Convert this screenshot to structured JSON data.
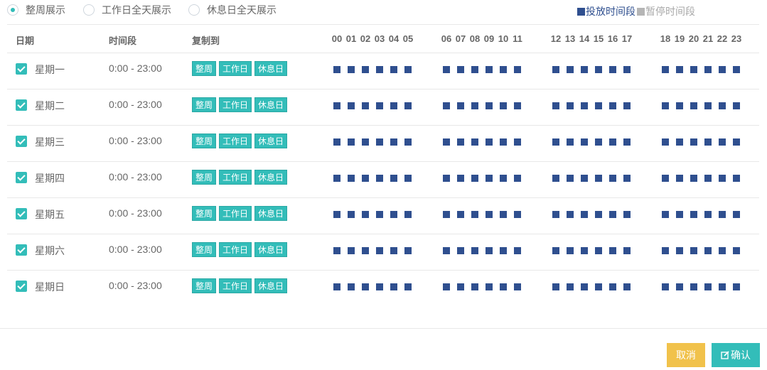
{
  "view_options": [
    {
      "label": "整周展示",
      "selected": true
    },
    {
      "label": "工作日全天展示",
      "selected": false
    },
    {
      "label": "休息日全天展示",
      "selected": false
    }
  ],
  "legend": {
    "active_label": "投放时间段",
    "paused_label": "暂停时间段",
    "active_color": "#2f4f8f",
    "paused_color": "#b5b5b5"
  },
  "table": {
    "headers": {
      "date": "日期",
      "time_range": "时间段",
      "copy_to": "复制到"
    },
    "hour_groups": [
      [
        "00",
        "01",
        "02",
        "03",
        "04",
        "05"
      ],
      [
        "06",
        "07",
        "08",
        "09",
        "10",
        "11"
      ],
      [
        "12",
        "13",
        "14",
        "15",
        "16",
        "17"
      ],
      [
        "18",
        "19",
        "20",
        "21",
        "22",
        "23"
      ]
    ],
    "copy_buttons": [
      "整周",
      "工作日",
      "休息日"
    ],
    "rows": [
      {
        "day": "星期一",
        "range": "0:00 - 23:00",
        "checked": true
      },
      {
        "day": "星期二",
        "range": "0:00 - 23:00",
        "checked": true
      },
      {
        "day": "星期三",
        "range": "0:00 - 23:00",
        "checked": true
      },
      {
        "day": "星期四",
        "range": "0:00 - 23:00",
        "checked": true
      },
      {
        "day": "星期五",
        "range": "0:00 - 23:00",
        "checked": true
      },
      {
        "day": "星期六",
        "range": "0:00 - 23:00",
        "checked": true
      },
      {
        "day": "星期日",
        "range": "0:00 - 23:00",
        "checked": true
      }
    ]
  },
  "footer": {
    "cancel_label": "取消",
    "confirm_label": "确认"
  },
  "colors": {
    "accent": "#33bdb9",
    "cancel": "#f1c24b",
    "slot_active": "#2f4f8f"
  }
}
